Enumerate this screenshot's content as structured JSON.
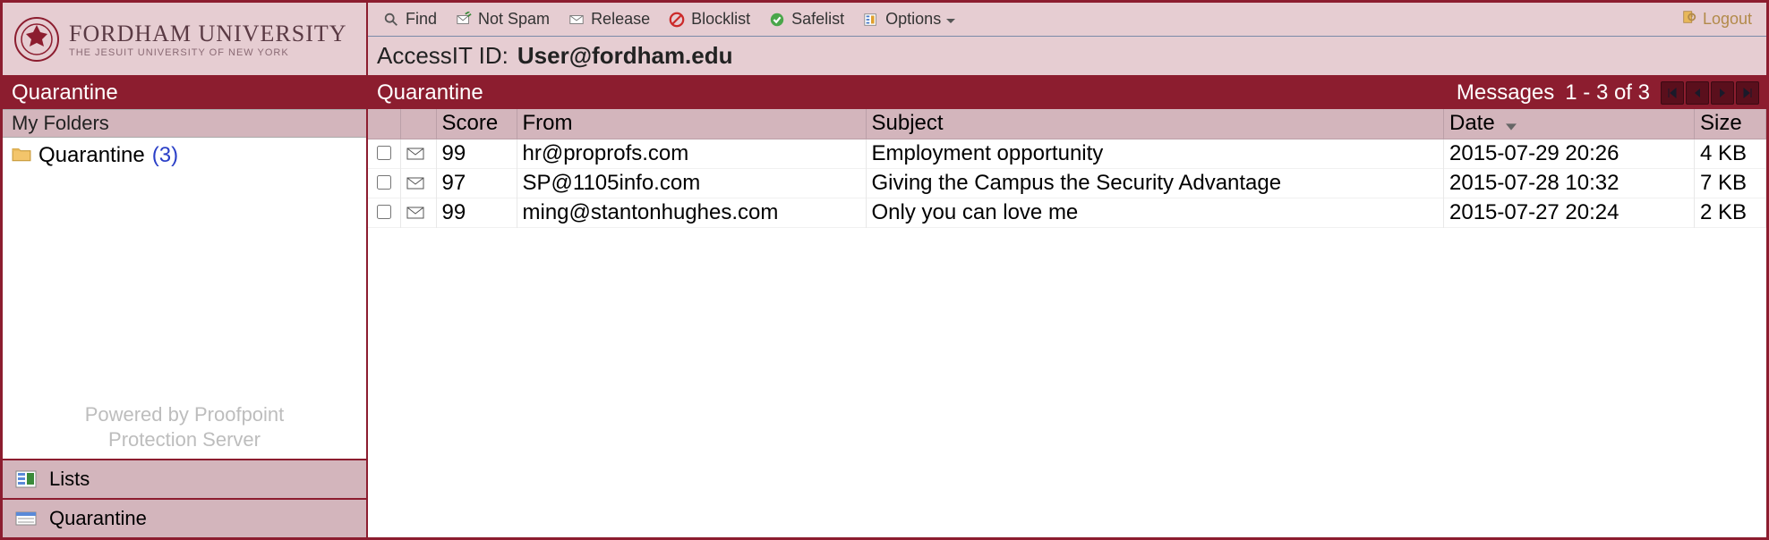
{
  "brand": {
    "title": "FORDHAM UNIVERSITY",
    "subtitle": "THE JESUIT UNIVERSITY OF NEW YORK"
  },
  "toolbar": {
    "find": "Find",
    "notspam": "Not Spam",
    "release": "Release",
    "blocklist": "Blocklist",
    "safelist": "Safelist",
    "options": "Options",
    "logout": "Logout"
  },
  "access": {
    "label": "AccessIT ID:",
    "value": "User@fordham.edu"
  },
  "sidebar": {
    "title": "Quarantine",
    "myfolders": "My Folders",
    "folder": {
      "name": "Quarantine",
      "count": "(3)"
    },
    "powered_l1": "Powered by Proofpoint",
    "powered_l2": "Protection Server",
    "nav_lists": "Lists",
    "nav_quarantine": "Quarantine"
  },
  "main": {
    "title": "Quarantine",
    "pager_label": "Messages",
    "pager_range": "1 - 3  of  3",
    "columns": {
      "score": "Score",
      "from": "From",
      "subject": "Subject",
      "date": "Date",
      "size": "Size"
    },
    "rows": [
      {
        "score": "99",
        "from": "hr@proprofs.com",
        "subject": "Employment opportunity",
        "date": "2015-07-29 20:26",
        "size": "4 KB"
      },
      {
        "score": "97",
        "from": "SP@1105info.com",
        "subject": "Giving the Campus the Security Advantage",
        "date": "2015-07-28 10:32",
        "size": "7 KB"
      },
      {
        "score": "99",
        "from": "ming@stantonhughes.com",
        "subject": "Only you can love me",
        "date": "2015-07-27 20:24",
        "size": "2 KB"
      }
    ]
  }
}
